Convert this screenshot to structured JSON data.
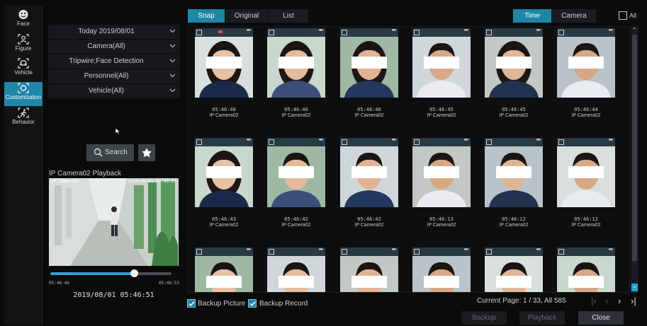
{
  "sidebar": {
    "items": [
      {
        "label": "Face",
        "icon": "face-icon"
      },
      {
        "label": "Figure",
        "icon": "figure-icon"
      },
      {
        "label": "Vehicle",
        "icon": "vehicle-icon"
      },
      {
        "label": "Customization",
        "icon": "customization-icon",
        "active": true
      },
      {
        "label": "Behavior",
        "icon": "behavior-icon"
      }
    ]
  },
  "filters": {
    "date": "Today 2019/08/01",
    "camera": "Camera(All)",
    "event": "Tripwire;Face Detection",
    "personnel": "Personnel(All)",
    "vehicle": "Vehicle(All)"
  },
  "search": {
    "label": "Search"
  },
  "playback": {
    "title": "IP Camera02 Playback",
    "osd_left": "IP Camera02",
    "osd_right": "2019/08/01 05:46:51",
    "start_time": "05:46:46",
    "end_time": "05:46:53",
    "current_time": "2019/08/01 05:46:51",
    "progress": 0.69
  },
  "view_tabs": {
    "snap": "Snap",
    "original": "Original",
    "list": "List"
  },
  "sort_tabs": {
    "time": "Time",
    "camera": "Camera"
  },
  "select_all_label": "All",
  "results": [
    {
      "time": "05:46:48",
      "camera": "IP Camera02",
      "rec": true
    },
    {
      "time": "05:46:46",
      "camera": "IP Camera02"
    },
    {
      "time": "05:46:46",
      "camera": "IP Camera02"
    },
    {
      "time": "05:46:45",
      "camera": "IP Camera02"
    },
    {
      "time": "05:46:45",
      "camera": "IP Camera02"
    },
    {
      "time": "05:46:44",
      "camera": "IP Camera02"
    },
    {
      "time": "05:46:43",
      "camera": "IP Camera02"
    },
    {
      "time": "05:46:42",
      "camera": "IP Camera02"
    },
    {
      "time": "05:46:42",
      "camera": "IP Camera02"
    },
    {
      "time": "05:46:13",
      "camera": "IP Camera02"
    },
    {
      "time": "05:46:12",
      "camera": "IP Camera02"
    },
    {
      "time": "05:46:12",
      "camera": "IP Camera02"
    },
    {
      "time": "",
      "camera": ""
    },
    {
      "time": "",
      "camera": ""
    },
    {
      "time": "",
      "camera": ""
    },
    {
      "time": "",
      "camera": ""
    },
    {
      "time": "",
      "camera": ""
    },
    {
      "time": "",
      "camera": ""
    }
  ],
  "footer": {
    "backup_picture": "Backup Picture",
    "backup_record": "Backup Record",
    "page_info": "Current Page: 1 / 33, All 585",
    "backup_button": "Backup",
    "playback_button": "Playback",
    "close_button": "Close"
  },
  "colors": {
    "accent": "#1f86a6",
    "background": "#0b0b0c"
  }
}
